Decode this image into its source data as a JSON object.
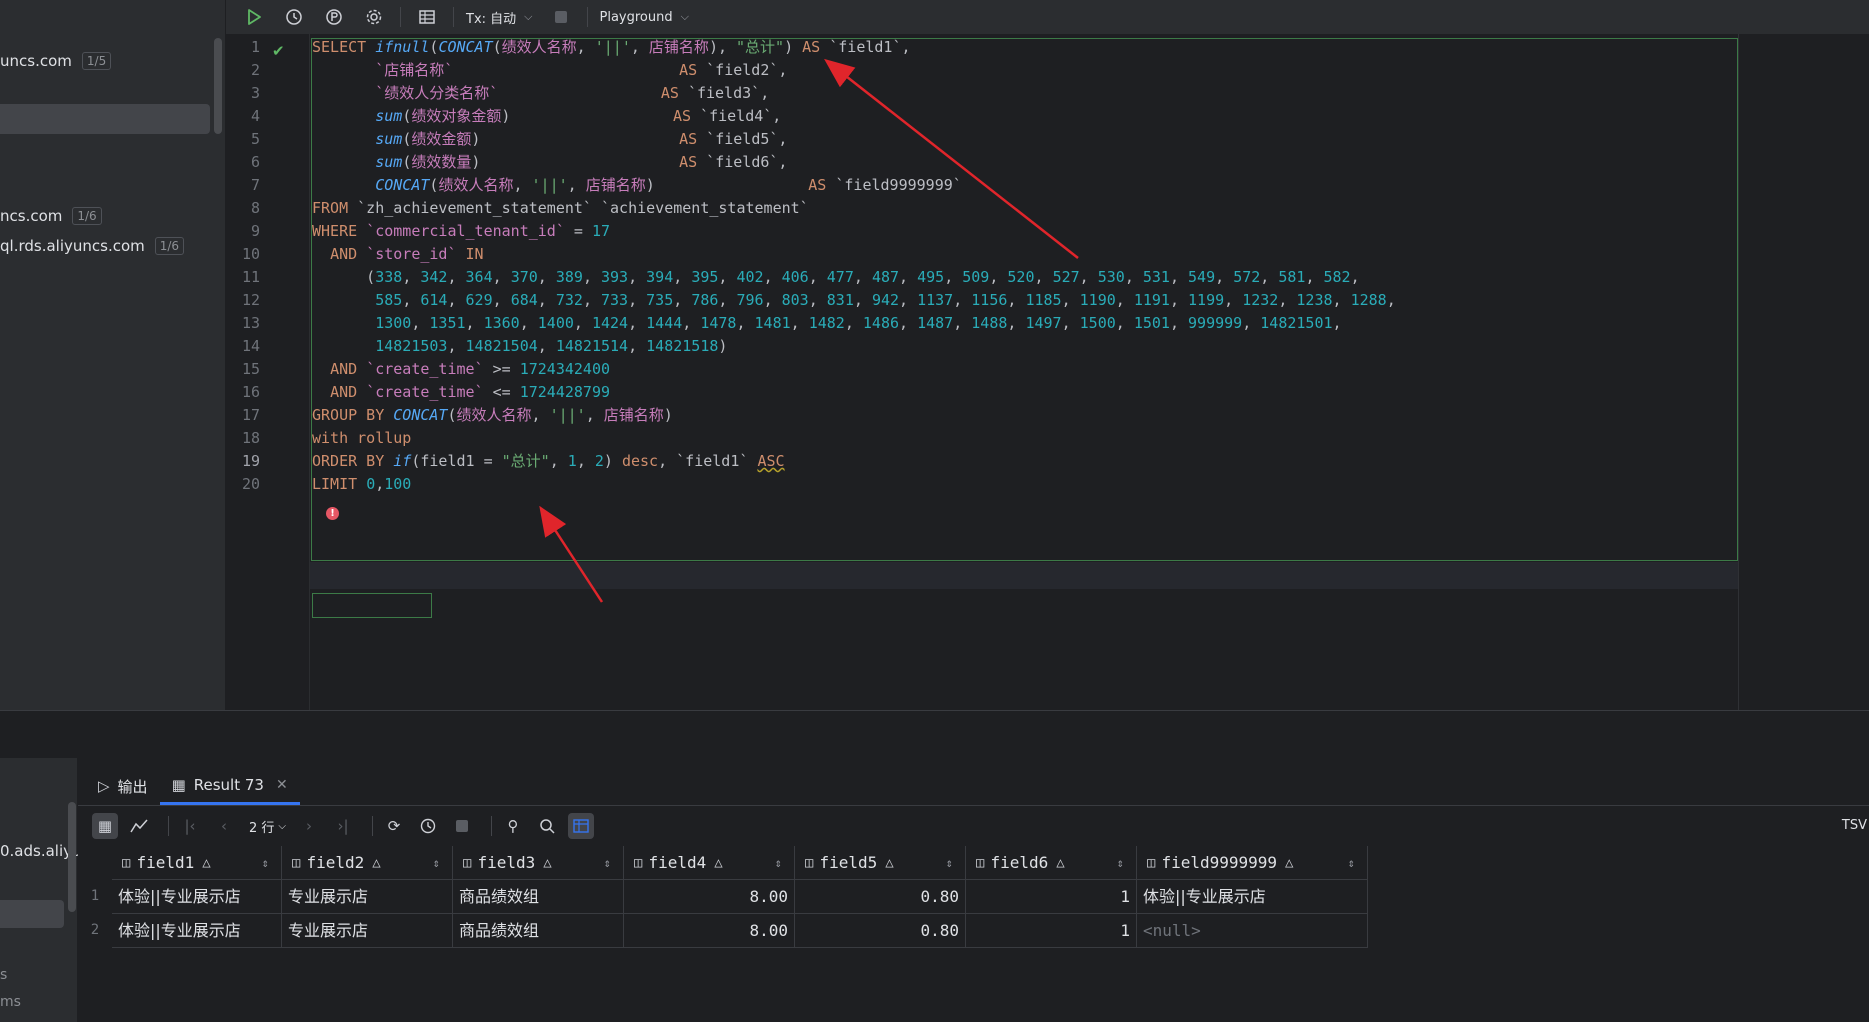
{
  "sidebar": {
    "items": [
      {
        "label": "uncs.com",
        "badge": "1/5"
      },
      {
        "label": "ncs.com",
        "badge": "1/6"
      },
      {
        "label": "ql.rds.aliyuncs.com",
        "badge": "1/6"
      }
    ]
  },
  "toolbar": {
    "tx_label": "Tx: 自动",
    "playground_label": "Playground"
  },
  "editor": {
    "line_numbers": [
      "1",
      "2",
      "3",
      "4",
      "5",
      "6",
      "7",
      "8",
      "9",
      "10",
      "11",
      "12",
      "13",
      "14",
      "15",
      "16",
      "17",
      "18",
      "19",
      "20"
    ],
    "current_line": "19"
  },
  "bottom_left": {
    "host_label": "0.ads.aliyu",
    "footer_text": "ms",
    "s_glyph": "s"
  },
  "results": {
    "tabs": [
      {
        "label": "输出",
        "icon": "output-icon"
      },
      {
        "label": "Result 73",
        "icon": "table-icon"
      }
    ],
    "rows_label": "2 行",
    "tsv_label": "TSV",
    "columns": [
      "field1",
      "field2",
      "field3",
      "field4",
      "field5",
      "field6",
      "field9999999"
    ],
    "rows": [
      {
        "n": "1",
        "cells": [
          "体验||专业展示店",
          "专业展示店",
          "商品绩效组",
          "8.00",
          "0.80",
          "1",
          "体验||专业展示店"
        ]
      },
      {
        "n": "2",
        "cells": [
          "体验||专业展示店",
          "专业展示店",
          "商品绩效组",
          "8.00",
          "0.80",
          "1",
          "<null>"
        ]
      }
    ]
  },
  "colors": {
    "accent": "#3574f0",
    "success": "#5fb865",
    "error": "#e55765",
    "arrow": "#e0252b"
  }
}
